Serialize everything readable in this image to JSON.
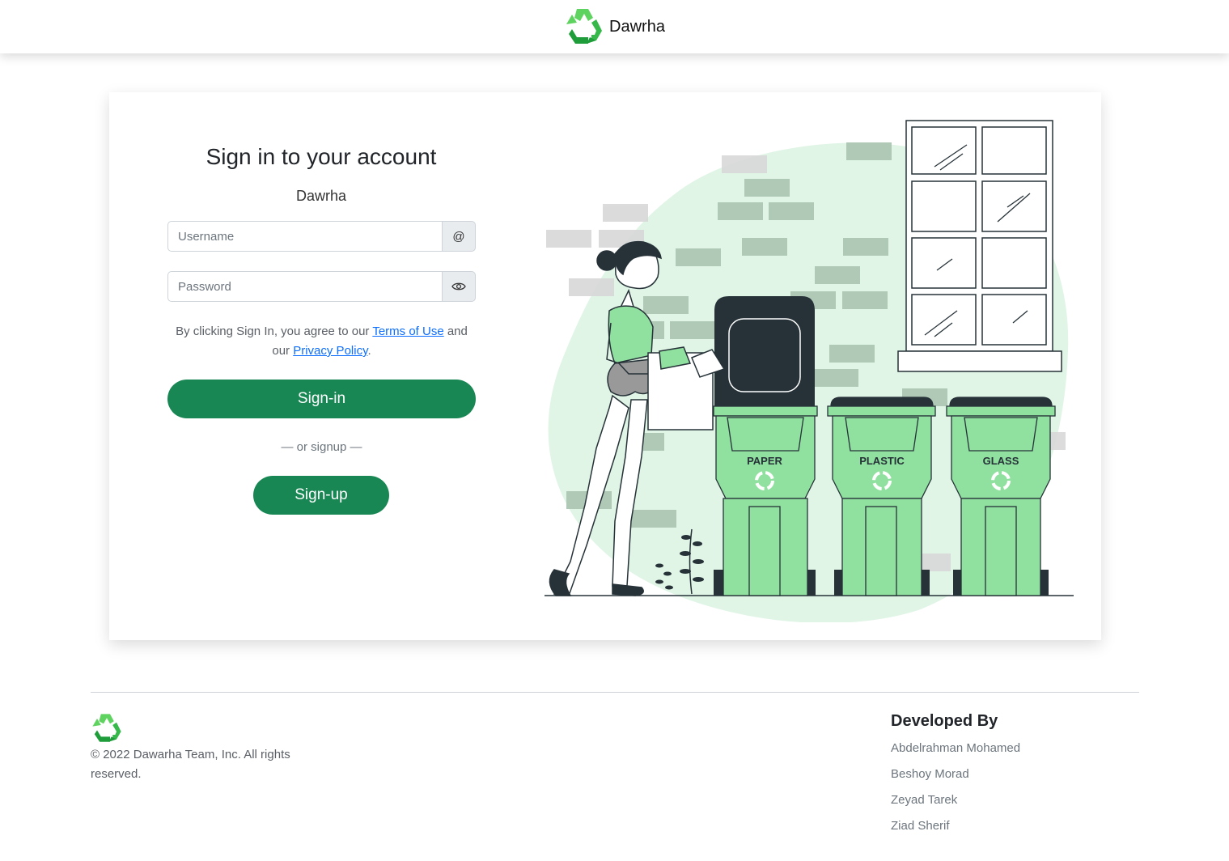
{
  "navbar": {
    "brand": "Dawrha",
    "logo_icon": "recycle-icon"
  },
  "login": {
    "title": "Sign in to your account",
    "subtitle": "Dawrha",
    "username_placeholder": "Username",
    "username_addon": "@",
    "password_placeholder": "Password",
    "password_addon_icon": "eye-icon",
    "terms_prefix": "By clicking Sign In, you agree to our",
    "terms_link": "Terms of Use",
    "terms_middle": "and our",
    "privacy_link": "Privacy Policy",
    "terms_suffix": ".",
    "signin_label": "Sign-in",
    "or_text": "— or signup —",
    "signup_label": "Sign-up"
  },
  "illustration": {
    "bins": [
      "PAPER",
      "PLASTIC",
      "GLASS"
    ],
    "colors": {
      "bin": "#90e0a0",
      "dark": "#263238",
      "blob": "#e0f5e6"
    }
  },
  "footer": {
    "copyright": "© 2022 Dawarha Team, Inc. All rights reserved.",
    "developed_by_title": "Developed By",
    "developers": [
      "Abdelrahman Mohamed",
      "Beshoy Morad",
      "Zeyad Tarek",
      "Ziad Sherif"
    ]
  },
  "colors": {
    "primary": "#198754",
    "link": "#0d6efd"
  }
}
